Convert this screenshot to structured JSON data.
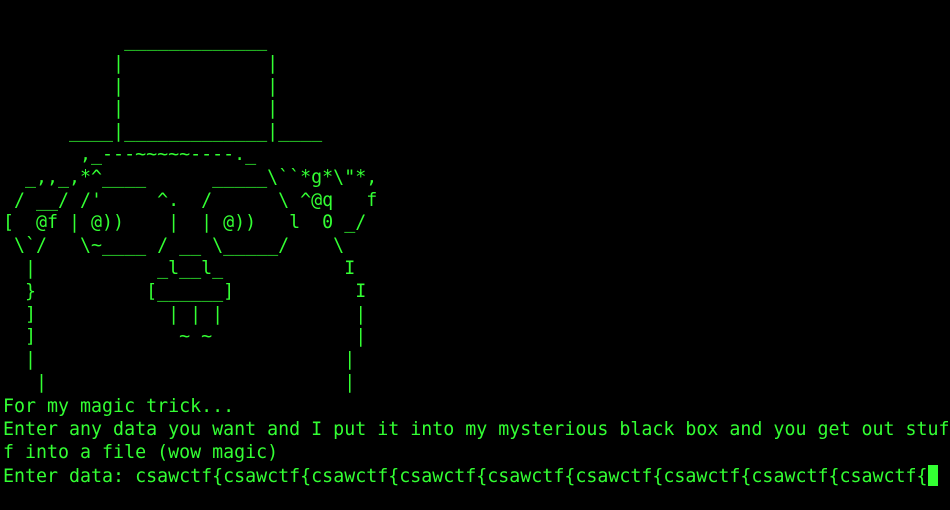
{
  "terminal": {
    "ascii_art": "           _____________\n          |             |\n          |             |\n          |             |\n      ____|_____________|____\n       ,_---~~~~~----._\n  _,,_,*^____      _____\\``*g*\\\"*,\n / __/ /'     ^.  /      \\ ^@q   f\n[  @f | @))    |  | @))   l  0 _/\n \\`/   \\~____ / __ \\_____/    \\\n  |           _l__l_           I\n  }          [______]           I\n  ]            | | |            |\n  ]             ~ ~             |\n  |                            |\n   |                           |",
    "output_lines": [
      "For my magic trick...",
      "Enter any data you want and I put it into my mysterious black box and you get out stuf",
      "f into a file (wow magic)"
    ],
    "prompt_label": "Enter data: ",
    "input_value": "csawctf{csawctf{csawctf{csawctf{csawctf{csawctf{csawctf{csawctf{csawctf{",
    "colors": {
      "background": "#000000",
      "foreground": "#33ff33"
    }
  }
}
